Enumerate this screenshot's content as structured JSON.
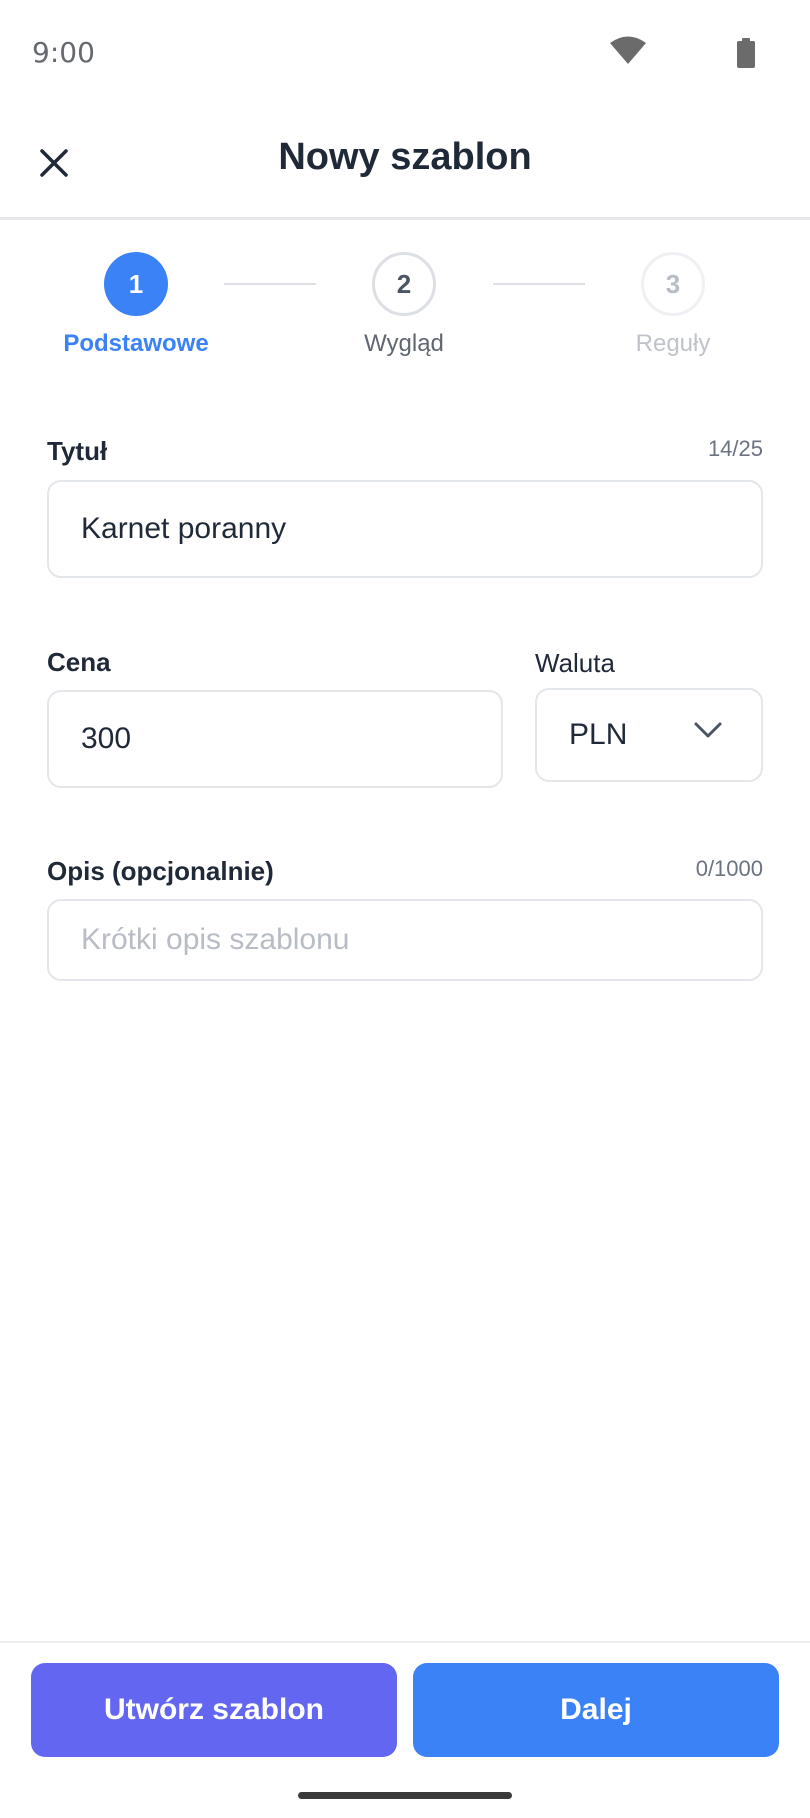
{
  "status_bar": {
    "time": "9:00",
    "wifi_icon": "wifi-icon",
    "battery_icon": "battery-icon"
  },
  "header": {
    "close_icon": "close-icon",
    "title": "Nowy szablon"
  },
  "stepper": {
    "steps": [
      {
        "number": "1",
        "label": "Podstawowe",
        "state": "active"
      },
      {
        "number": "2",
        "label": "Wygląd",
        "state": "upcoming"
      },
      {
        "number": "3",
        "label": "Reguły",
        "state": "disabled"
      }
    ]
  },
  "form": {
    "title": {
      "label": "Tytuł",
      "value": "Karnet poranny",
      "counter": "14/25"
    },
    "price": {
      "label": "Cena",
      "value": "300"
    },
    "currency": {
      "label": "Waluta",
      "value": "PLN",
      "icon": "chevron-down-icon"
    },
    "description": {
      "label": "Opis (opcjonalnie)",
      "placeholder": "Krótki opis szablonu",
      "value": "",
      "counter": "0/1000"
    }
  },
  "actions": {
    "create_label": "Utwórz szablon",
    "next_label": "Dalej"
  },
  "colors": {
    "primary": "#3b82f6",
    "create_button": "#6366f1",
    "text": "#1f2937",
    "border": "#e3e6ea"
  }
}
